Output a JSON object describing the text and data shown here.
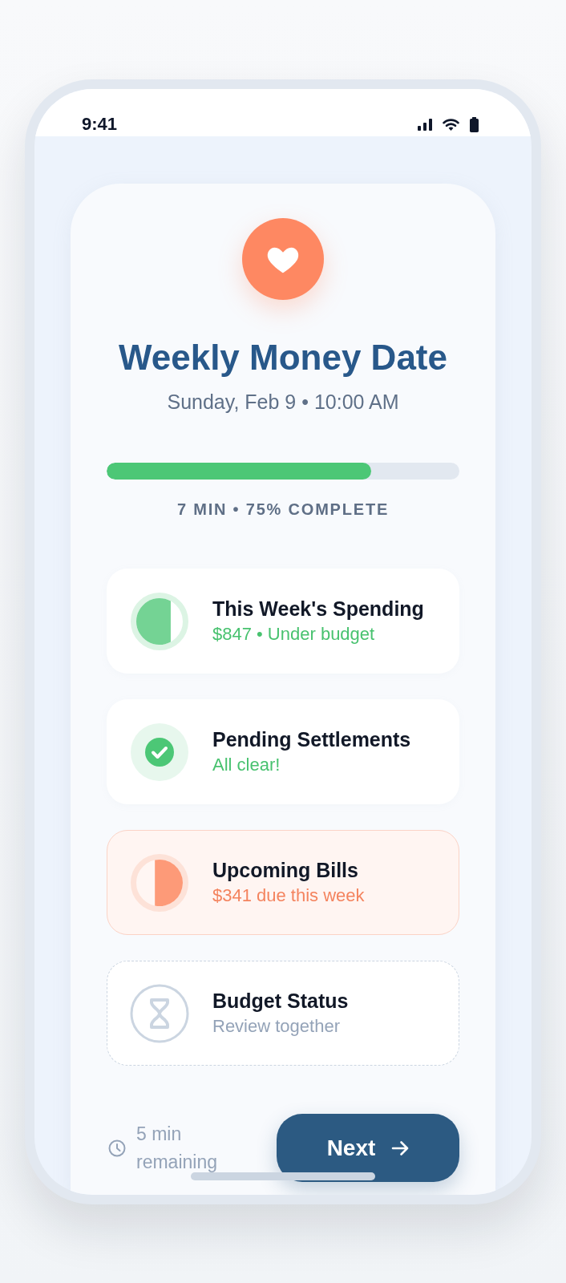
{
  "status_bar": {
    "time": "9:41"
  },
  "header": {
    "title": "Weekly Money Date",
    "subtitle": "Sunday, Feb 9 • 10:00 AM"
  },
  "progress": {
    "level": 0.75,
    "label": "7 MIN • 75% COMPLETE"
  },
  "items": [
    {
      "kind": "good",
      "title": "This Week's Spending",
      "detail": "$847 • Under budget"
    },
    {
      "kind": "done",
      "title": "Pending Settlements",
      "detail": "All clear!"
    },
    {
      "kind": "alert",
      "title": "Upcoming Bills",
      "detail": "$341 due this week"
    },
    {
      "kind": "todo",
      "title": "Budget Status",
      "detail": "Review together"
    }
  ],
  "footer": {
    "remaining": "5 min remaining",
    "next_button": "Next"
  }
}
